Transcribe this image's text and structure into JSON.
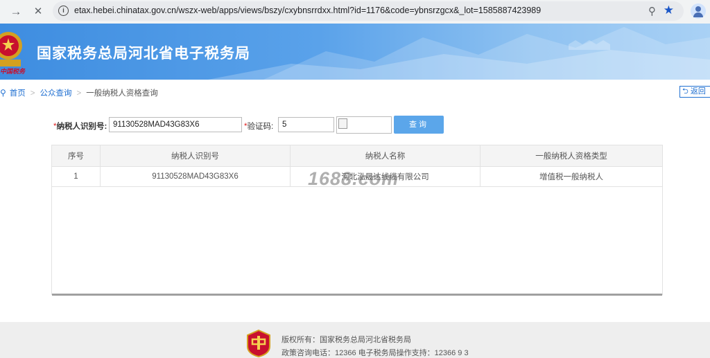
{
  "browser": {
    "back_icon": "→",
    "close_icon": "✕",
    "url": "etax.hebei.chinatax.gov.cn/wszx-web/apps/views/bszy/cxybnsrrdxx.html?id=1176&code=ybnsrzgcx&_lot=1585887423989"
  },
  "header": {
    "site_title": "国家税务总局河北省电子税务局",
    "emblem_text": "中国税务"
  },
  "breadcrumb": {
    "home": "首页",
    "sep": ">",
    "public_query": "公众查询",
    "current": "一般纳税人资格查询",
    "back_label": "返回"
  },
  "form": {
    "required_mark": "*",
    "taxpayer_id_label": "纳税人识别号:",
    "taxpayer_id_value": "91130528MAD43G83X6",
    "captcha_label": "验证码:",
    "captcha_value": "5",
    "query_button": "查询"
  },
  "table": {
    "headers": [
      "序号",
      "纳税人识别号",
      "纳税人名称",
      "一般纳税人资格类型"
    ],
    "rows": [
      [
        "1",
        "91130528MAD43G83X6",
        "河北泓晟达线缆有限公司",
        "增值税一般纳税人"
      ]
    ]
  },
  "watermark": "1688.com",
  "footer": {
    "copyright": "版权所有：国家税务总局河北省税务局",
    "contact": "政策咨询电话：12366  电子税务局操作支持：12366 9 3"
  },
  "colors": {
    "banner": "#3e8de0",
    "link": "#1f6fd1",
    "button": "#5ba6ea",
    "required": "#e02020"
  }
}
